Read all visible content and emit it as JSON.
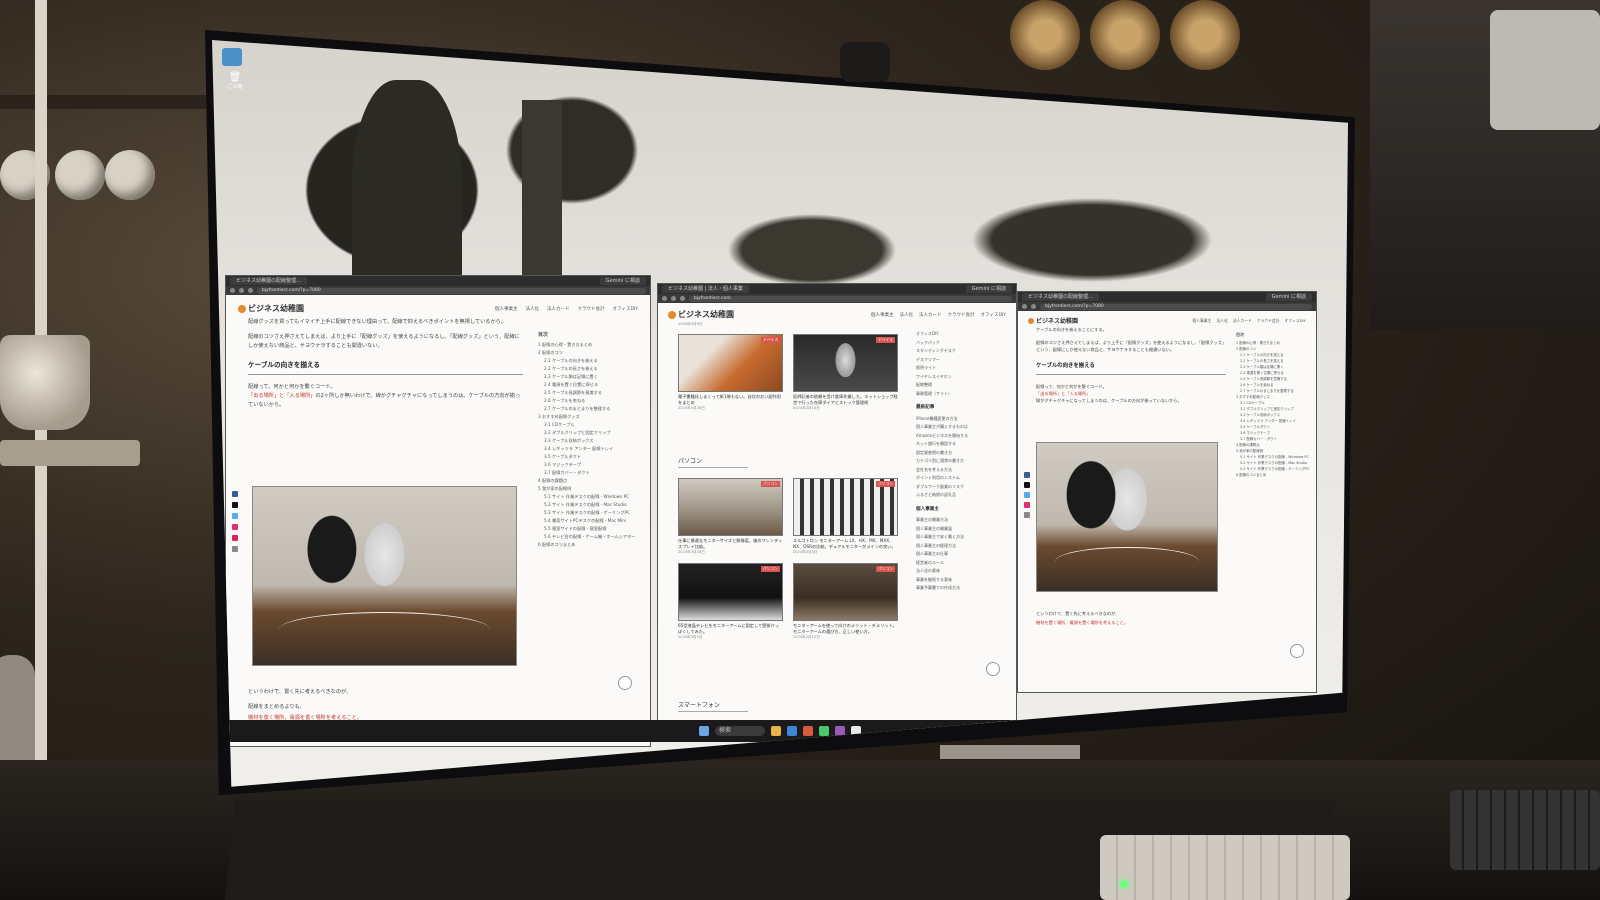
{
  "colors": {
    "brand_orange": "#e58a2c",
    "link_red": "#c0392b",
    "page_bg": "#fbfaf8",
    "badge_red": "#d9534f"
  },
  "desktop": {
    "icon_label": "ごみ箱",
    "taskbar_search": "検索"
  },
  "windows": {
    "left": {
      "tab_title": "ビジネス幼稚園の配線整理...",
      "tab2_title": "Gemini に相談",
      "url": "bjyfrontiers.com/?p=7080",
      "logo": "ビジネス幼稚園",
      "nav": [
        "個人事業主",
        "法人化",
        "法人カード",
        "クラウド会計",
        "オフィスDIY"
      ],
      "para1": "配線グッズを買ってもイマイチ上手に配線できない理由って、配線で抑えるべきポイントを無視しているから。",
      "para2": "配線のコツさえ押さえてしまえば、より上手に「配線グッズ」を使えるようになるし、「配線グッズ」という、配線にしか使えない商品と、サヨウナラすることも間違いない。",
      "heading": "ケーブルの向きを揃える",
      "para3_pre": "配線って、何かと何かを繋ぐコード。",
      "para3_red": "「出る場所」と「入る場所」",
      "para3_post": "の2ヶ所しか無いわけで、線がグチャグチャになってしまうのは、ケーブルの方向が揃っていないから。",
      "para4": "というわけで、置く先に考えるべきなのが、",
      "para5": "配線をまとめるよりも、",
      "para6_red": "機材を置く場所、電源を置く場所を考えること。",
      "toc_title": "目次",
      "toc": [
        "1 配線の心得・置き方まとめ",
        "2 配線のコツ",
        "2.1 ケーブルの向きを揃える",
        "2.2 ケーブルの長さを揃える",
        "2.3 ケーブル類は足場に置く",
        "2.4 電源を置く位置に寄せる",
        "2.5 ケーブル長調節を意識する",
        "2.6 ケーブルを束ねる",
        "2.7 ケーブルのまとまりを整理する",
        "3 おすすめ配線グッズ",
        "3.1 CDケーブル",
        "3.2 ダブルクリップと固定クリップ",
        "3.3 ケーブル収納ボックス",
        "3.4 レギッツラ アンダー 配線トレイ",
        "3.5 ケーブルダクト",
        "3.6 マジックテープ",
        "3.7 配線カバー・ダクト",
        "4 配線の課題点",
        "5 我が家の配線例",
        "5.1 サイト 作業デスクの配線 - Windows PC",
        "5.2 サイト 作業デスクの配線 - Mac Studio",
        "5.3 サイト 作業デスクの配線 - ゲーミングPC",
        "5.4 書斎サイトPCデスクの配線 - Mac Mini",
        "5.5 寝室サイドの配線 - 寝室配線",
        "5.6 テレビ台の配線 - ゲーム機・ホームシアター",
        "6 配線のコツまとめ"
      ]
    },
    "middle": {
      "tab_title": "ビジネス幼稚園 | 法人・個人事業",
      "tab2_title": "Gemini に相談",
      "url": "bjyfrontiers.com",
      "logo": "ビジネス幼稚園",
      "nav": [
        "個人事業主",
        "法人化",
        "法人カード",
        "クラウド会計",
        "オフィスDIY"
      ],
      "date_top": "2024年4月9日",
      "cards_top": [
        {
          "title": "電子書籍化しまくって紙1冊もない。自炊のおい副作用をまとめ",
          "date": "2024年3月28日",
          "badge": "デバイス"
        },
        {
          "title": "医師記者の依頼を受け倉庫作業した。ネットショップ経営で行った在庫ダイアとストック管理術",
          "date": "2024年3月14日",
          "badge": "デバイス"
        }
      ],
      "section": "パソコン",
      "cards_pc": [
        {
          "title": "仕事に最適なモニターサイズと解像度。後のフレンディスプレイ比較。",
          "date": "2024年3月28日",
          "badge": "パソコン"
        },
        {
          "title": "エルゴトロン モニターアーム LX、HX、MX、MXX、NX、OSRの比較。デュアルモニターがメインの良い。",
          "date": "2024年4月4日",
          "badge": "パソコン"
        },
        {
          "title": "65型液晶テレビをモニターアームに固定して壁掛けっぽくしてみた。",
          "date": "2024年3月1日",
          "badge": "パソコン"
        },
        {
          "title": "モニターアームを使って向けのメリット・デメリット。モニターアームの選び方、正しい使い方。",
          "date": "2024年2月22日",
          "badge": "パソコン"
        }
      ],
      "section2": "スマートフォン",
      "sidebar_top": [
        "オフィスDIY",
        "バックパック",
        "スタンディングデスク",
        "デスクツアー",
        "照明ライト",
        "ワイヤレスイヤホン",
        "配線整理",
        "事務管理（サイト）"
      ],
      "sidebar_title": "最新記事",
      "sidebar_recent": [
        "iPhone機種変更の方法",
        "個人事業主が購入するものは",
        "Amazonビジネスを開始する",
        "ネット銀行を開設する",
        "固定資産税の書き方",
        "カテゴリ別に通常の書き方",
        "会社名を考える方法",
        "ポイント利用のシステム",
        "ダブルワーク副業のリスク",
        "ふるさと納税の返礼品"
      ],
      "sidebar_title2": "個人事業主",
      "sidebar_biz": [
        "事業主の開業方法",
        "個人事業主の開業届",
        "個人事業主で安く働く方法",
        "個人事業主の経理方法",
        "個人事業主の仕事",
        "経営者のルール",
        "法人化の意味",
        "事業を継続する意味",
        "事業予算書での作成方法"
      ]
    },
    "right": {
      "tab_title": "ビジネス幼稚園の配線整理...",
      "tab2_title": "Gemini に相談",
      "url": "bjyfrontiers.com/?p=7080",
      "logo": "ビジネス幼稚園",
      "nav": [
        "個人事業主",
        "法人化",
        "法人カード",
        "クラウド会計",
        "オフィスDIY"
      ],
      "para0": "ケーブルの向きを揃えることにする。",
      "para1": "配線のコツさえ押さえてしまえば、より上手に「配線グッズ」を使えるようになるし、「配線グッズ」という、配線にしか使えない商品と、サヨウナラすることも間違いない。",
      "heading": "ケーブルの向きを揃える",
      "para2": "配線って、何かと何かを繋ぐコード。",
      "para2_red": "「出る場所」と「入る場所」",
      "para2_post": "線がグチャグチャになってしまうのは、ケーブルの方向が揃っていないから。",
      "para3": "というわけで、置く先に考えるべきなのが、",
      "para4_red": "機材を置く場所、電源を置く場所を考えること。",
      "toc_title": "目次"
    }
  }
}
